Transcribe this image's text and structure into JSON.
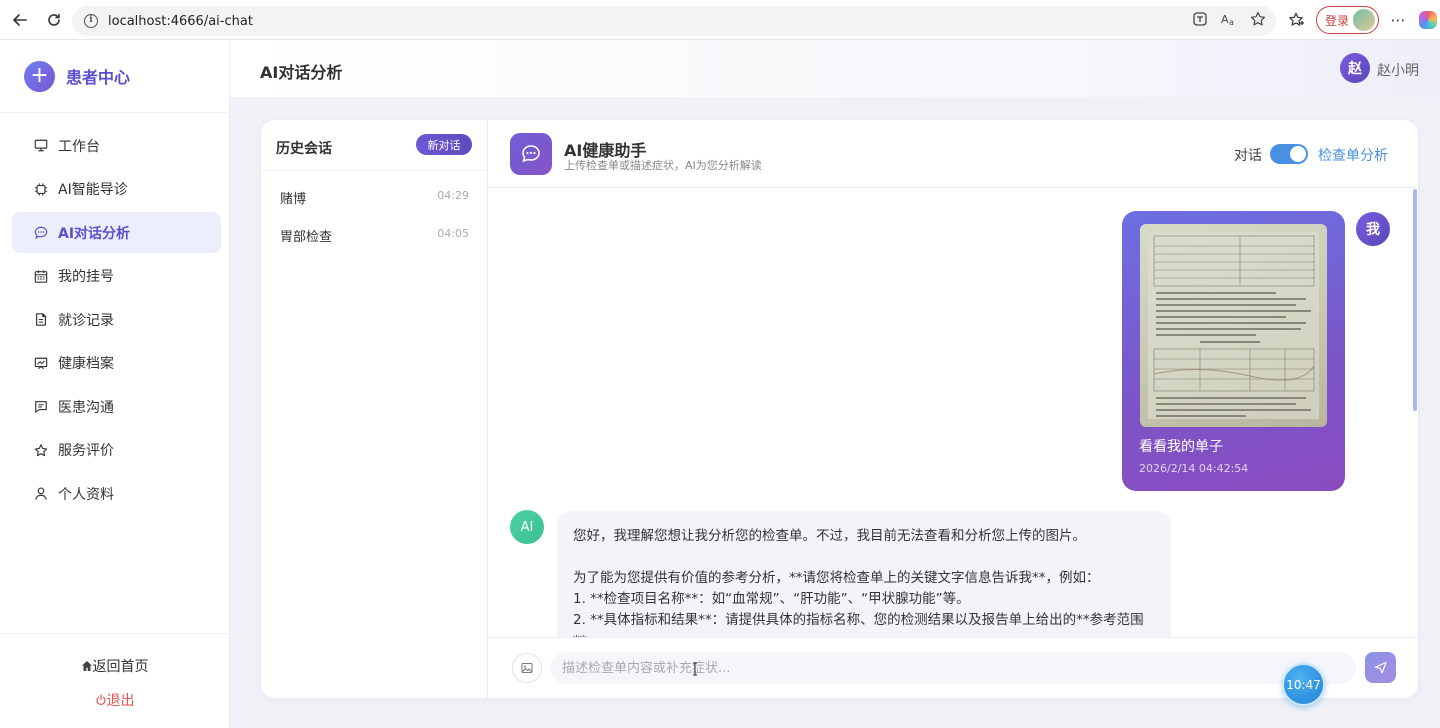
{
  "browser": {
    "url": "localhost:4666/ai-chat",
    "login_label": "登录"
  },
  "sidebar": {
    "brand": "患者中心",
    "items": [
      {
        "label": "工作台",
        "icon": "monitor-icon",
        "active": false
      },
      {
        "label": "AI智能导诊",
        "icon": "chip-icon",
        "active": false
      },
      {
        "label": "AI对话分析",
        "icon": "chat-icon",
        "active": true
      },
      {
        "label": "我的挂号",
        "icon": "calendar-icon",
        "active": false
      },
      {
        "label": "就诊记录",
        "icon": "document-icon",
        "active": false
      },
      {
        "label": "健康档案",
        "icon": "chart-board-icon",
        "active": false
      },
      {
        "label": "医患沟通",
        "icon": "message-icon",
        "active": false
      },
      {
        "label": "服务评价",
        "icon": "star-icon",
        "active": false
      },
      {
        "label": "个人资料",
        "icon": "user-icon",
        "active": false
      }
    ],
    "home": "返回首页",
    "logout": "退出"
  },
  "header": {
    "title": "AI对话分析",
    "avatar_char": "赵",
    "user_name": "赵小明"
  },
  "history": {
    "title": "历史会话",
    "new_chat": "新对话",
    "items": [
      {
        "title": "赌博",
        "time": "04:29"
      },
      {
        "title": "胃部检查",
        "time": "04:05"
      }
    ]
  },
  "chat": {
    "bot_name": "AI健康助手",
    "bot_subtitle": "上传检查单或描述症状，AI为您分析解读",
    "mode_dialog": "对话",
    "mode_report": "检查单分析",
    "toggle_on": true,
    "user_avatar": "我",
    "user_message": {
      "text": "看看我的单子",
      "time": "2026/2/14 04:42:54"
    },
    "ai_avatar": "AI",
    "ai_message": {
      "line1": "您好，我理解您想让我分析您的检查单。不过，我目前无法查看和分析您上传的图片。",
      "line2": "为了能为您提供有价值的参考分析，**请您将检查单上的关键文字信息告诉我**，例如：",
      "line3": "1.  **检查项目名称**：如“血常规”、“肝功能”、“甲状腺功能”等。",
      "line4": "2.  **具体指标和结果**：请提供具体的指标名称、您的检测结果以及报告单上给出的**参考范围",
      "line5": "**"
    },
    "input_placeholder": "描述检查单内容或补充症状..."
  },
  "clock": "10:47",
  "colors": {
    "accent": "#5b4fd0",
    "toggle": "#4a90e2",
    "logout": "#e55353",
    "ai_avatar": "#3bbf95"
  }
}
